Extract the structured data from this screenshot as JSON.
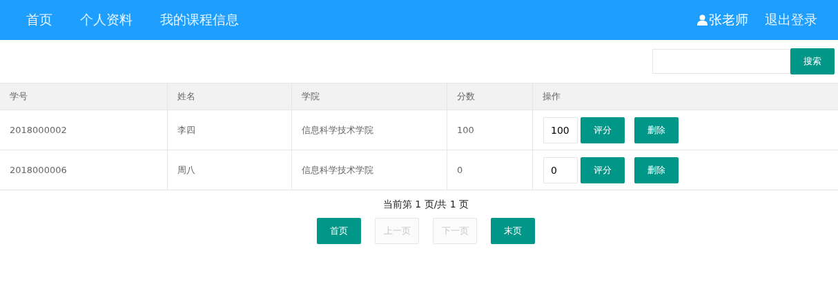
{
  "nav": {
    "links": [
      "首页",
      "个人资料",
      "我的课程信息"
    ],
    "user": "张老师",
    "logout": "退出登录"
  },
  "search": {
    "button": "搜索"
  },
  "table": {
    "columns": [
      "学号",
      "姓名",
      "学院",
      "分数",
      "操作"
    ],
    "rows": [
      {
        "id": "2018000002",
        "name": "李四",
        "college": "信息科学技术学院",
        "score": "100",
        "input": "100",
        "grade_button": "评分",
        "delete_button": "删除"
      },
      {
        "id": "2018000006",
        "name": "周八",
        "college": "信息科学技术学院",
        "score": "0",
        "input": "0",
        "grade_button": "评分",
        "delete_button": "删除"
      }
    ]
  },
  "pager": {
    "status": "当前第 1 页/共 1 页",
    "buttons": [
      {
        "label": "首页",
        "disabled": false
      },
      {
        "label": "上一页",
        "disabled": true
      },
      {
        "label": "下一页",
        "disabled": true
      },
      {
        "label": "末页",
        "disabled": false
      }
    ]
  }
}
